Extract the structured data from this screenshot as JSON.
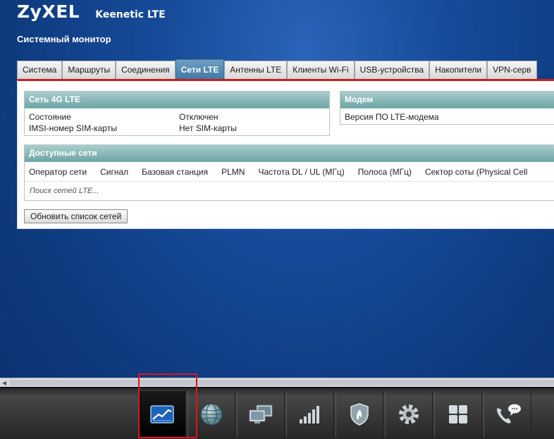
{
  "header": {
    "logo": "ZyXEL",
    "model": "Keenetic LTE"
  },
  "page_title": "Системный монитор",
  "tabs": [
    {
      "label": "Система",
      "active": false
    },
    {
      "label": "Маршруты",
      "active": false
    },
    {
      "label": "Соединения",
      "active": false
    },
    {
      "label": "Сети LTE",
      "active": true
    },
    {
      "label": "Антенны LTE",
      "active": false
    },
    {
      "label": "Клиенты Wi-Fi",
      "active": false
    },
    {
      "label": "USB-устройства",
      "active": false
    },
    {
      "label": "Накопители",
      "active": false
    },
    {
      "label": "VPN-серв",
      "active": false
    }
  ],
  "lte": {
    "title": "Сеть 4G LTE",
    "rows": [
      {
        "key": "Состояние",
        "value": "Отключен"
      },
      {
        "key": "IMSI-номер SIM-карты",
        "value": "Нет SIM-карты"
      }
    ]
  },
  "modem": {
    "title": "Модем",
    "rows": [
      {
        "key": "Версия ПО LTE-модема",
        "value": ""
      }
    ]
  },
  "networks": {
    "title": "Доступные сети",
    "columns": [
      "Оператор сети",
      "Сигнал",
      "Базовая станция",
      "PLMN",
      "Частота DL / UL (МГц)",
      "Полоса (МГц)",
      "Сектор соты (Physical Cell"
    ],
    "status": "Поиск сетей LTE..."
  },
  "refresh_button": "Обновить список сетей",
  "dock": [
    {
      "icon": "system-monitor-icon",
      "active": true
    },
    {
      "icon": "internet-globe-icon",
      "active": false
    },
    {
      "icon": "home-network-icon",
      "active": false
    },
    {
      "icon": "signal-bars-icon",
      "active": false
    },
    {
      "icon": "security-shield-icon",
      "active": false
    },
    {
      "icon": "settings-gear-icon",
      "active": false
    },
    {
      "icon": "applications-icon",
      "active": false
    },
    {
      "icon": "phone-icon",
      "active": false
    }
  ],
  "colors": {
    "accent_red": "#c8201e",
    "active_tab": "#3d78a6",
    "box_header": "#6fa6a6",
    "background": "#164a98"
  }
}
